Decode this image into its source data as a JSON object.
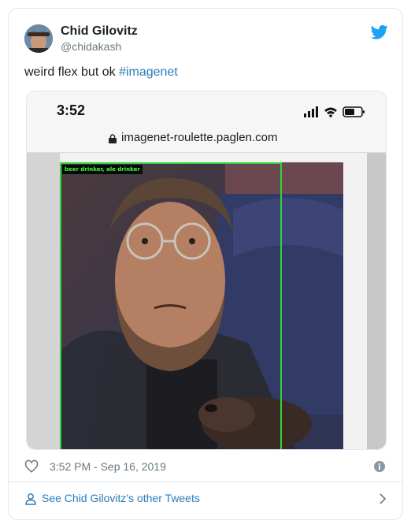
{
  "tweet": {
    "author_name": "Chid Gilovitz",
    "author_handle": "@chidakash",
    "text_main": "weird flex but ok ",
    "hashtag": "#imagenet",
    "timestamp": "3:52 PM - Sep 16, 2019",
    "footer_link": "See Chid Gilovitz's other Tweets"
  },
  "media": {
    "clock": "3:52",
    "url": "imagenet-roulette.paglen.com",
    "bbox_label": "beer drinker, ale drinker"
  },
  "colors": {
    "link": "#2b7bb9",
    "bbox": "#2fd33a",
    "twitter_blue": "#1da1f2"
  }
}
